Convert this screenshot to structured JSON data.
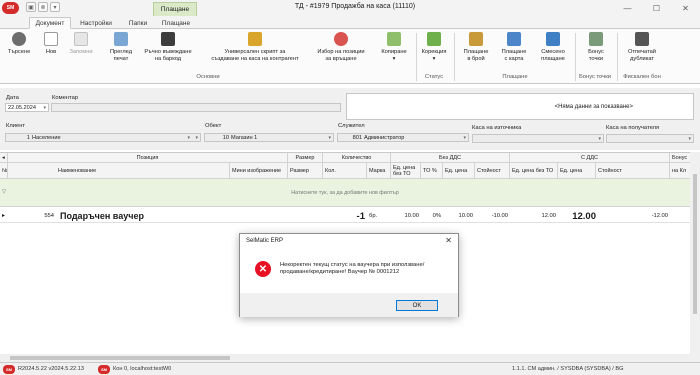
{
  "app": {
    "logo_text": "SM",
    "window_title": "ТД - #1979 Продажба на каса (11110)",
    "context_tab": "Плащане",
    "window_controls": {
      "minimize": "—",
      "maximize": "☐",
      "close": "✕"
    }
  },
  "tabs": [
    "Документ",
    "Настройки",
    "Папки",
    "Плащане"
  ],
  "ribbon": {
    "buttons": {
      "search": "Търсене",
      "new": "Нов",
      "save": "Запомни",
      "preview_line1": "Преглед",
      "preview_line2": "печат",
      "barcode_line1": "Ръчно въвеждане",
      "barcode_line2": "на баркод",
      "script_line1": "Универсален скрипт за",
      "script_line2": "създаване на каса на контрагент",
      "return_line1": "Избор на позиции",
      "return_line2": "за връщане",
      "copy": "Копиране",
      "correction": "Корекция",
      "pay_cash_line1": "Плащане",
      "pay_cash_line2": "в брой",
      "pay_card_line1": "Плащане",
      "pay_card_line2": "с карта",
      "pay_mixed_line1": "Смесено",
      "pay_mixed_line2": "плащане",
      "bonus_line1": "Бонус",
      "bonus_line2": "точки",
      "duplicate_line1": "Отпечатай",
      "duplicate_line2": "дубликат"
    },
    "groups": {
      "basic": "Основни",
      "status": "Статус",
      "payment": "Плащане",
      "bonus": "Бонус точки",
      "fiscal": "Фискален бон"
    }
  },
  "form": {
    "date_label": "Дата",
    "date_value": "22.05.2024",
    "comment_label": "Коментар",
    "comment_value": "",
    "nodata_text": "<Няма данни за показване>",
    "client_label": "Клиент",
    "client_code": "1",
    "client_name": "Население",
    "object_label": "Обект",
    "object_code": "10",
    "object_name": "Магазин 1",
    "employee_label": "Служител",
    "employee_code": "801",
    "employee_name": "Администратор",
    "source_cash_label": "Каса на източника",
    "target_cash_label": "Каса на получателя"
  },
  "grid": {
    "group_headers": {
      "position": "Позиция",
      "size": "Размер",
      "quantity": "Количество",
      "no_vat": "Без ДДС",
      "with_vat": "С ДДС",
      "bonus": "Бонус"
    },
    "columns": {
      "num": "№",
      "name": "Наименование",
      "mini_image": "Мини изображение",
      "size": "Размер",
      "qty": "Кол.",
      "unit": "Марка",
      "unit_price_no_tax_line1": "Ед. цена",
      "unit_price_no_tax_line2": "без ТО",
      "to_pct": "ТО %",
      "unit_price": "Ед. цена",
      "value": "Стойност",
      "unit_price_no_to": "Ед. цена без ТО",
      "unit_price_vat": "Ед. цена",
      "value_vat": "Стойност",
      "bonus_col": "на Кл"
    },
    "filter_hint": "Натиснете тук, за да добавите нов филтър",
    "row": {
      "code": "554",
      "name": "Подаръчен ваучер",
      "qty": "-1",
      "unit": "бр.",
      "price_no_to": "10.00",
      "to_pct": "0%",
      "price": "10.00",
      "value": "-10.00",
      "price_vat_no_to": "12.00",
      "price_vat": "12.00",
      "value_vat": "-12.00"
    }
  },
  "status_bar": {
    "logo_text": "SM",
    "version": "R2024.5.22 v2024.5.22.13",
    "connection": "Кон 0, localhost:testW0",
    "user": "1.1.1. СМ админ. / SYSDBA (SYSDBA) / BG"
  },
  "dialog": {
    "title": "SelMatic ERP",
    "close": "✕",
    "icon": "✕",
    "message": "Некоректен текущ статус на ваучера при използване/продаване/кредитиране! Ваучер № 0001212",
    "ok": "OK"
  },
  "colors": {
    "ribbon_accent": "#dbe9c9",
    "filter_row": "#e9f3df",
    "error_red": "#e81123",
    "logo_red": "#d42a2a"
  }
}
